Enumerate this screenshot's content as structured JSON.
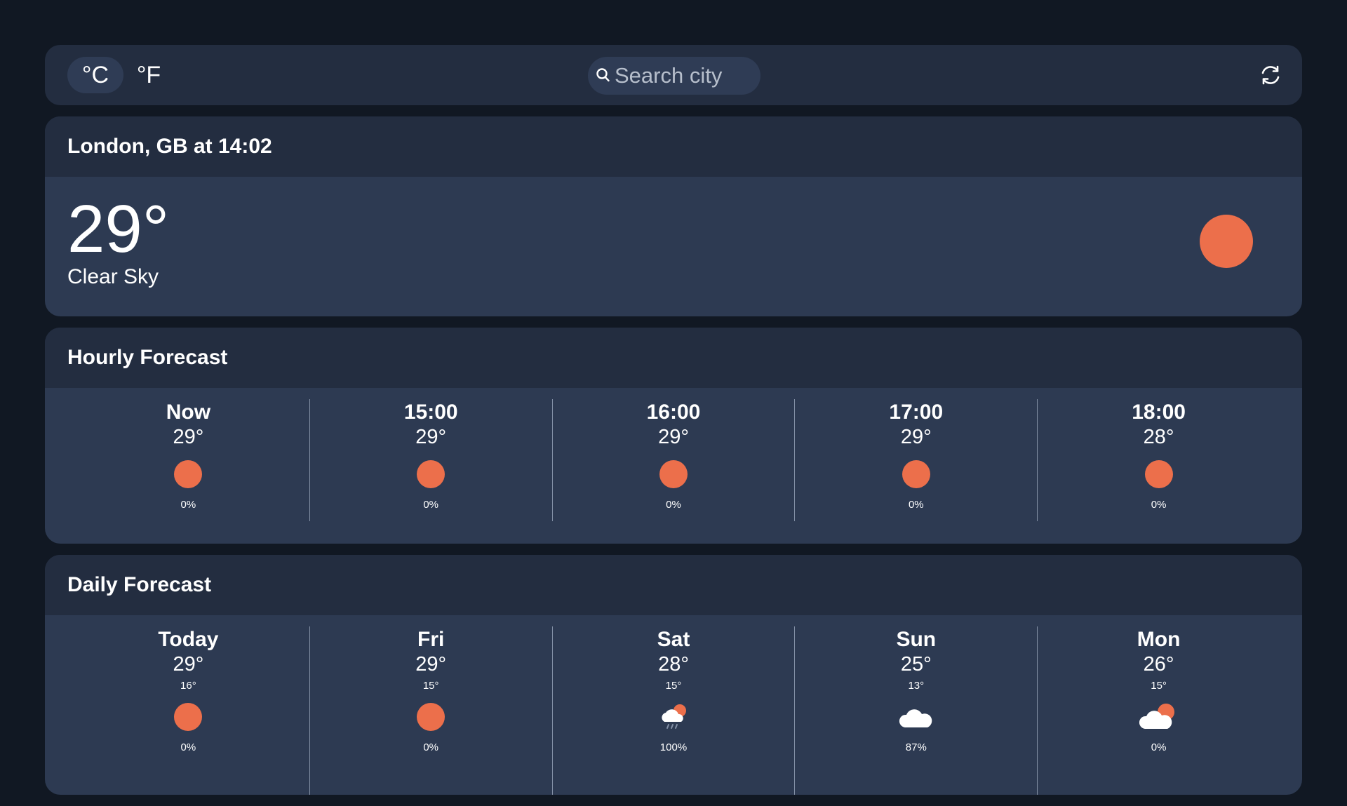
{
  "toolbar": {
    "unit_celsius": "°C",
    "unit_fahrenheit": "°F",
    "search_placeholder": "Search city"
  },
  "current": {
    "location": "London, GB at 14:02",
    "temperature": "29°",
    "condition": "Clear Sky",
    "icon": "sun-icon"
  },
  "hourly": {
    "title": "Hourly Forecast",
    "items": [
      {
        "time": "Now",
        "temp": "29°",
        "precip": "0%",
        "icon": "sun-icon"
      },
      {
        "time": "15:00",
        "temp": "29°",
        "precip": "0%",
        "icon": "sun-icon"
      },
      {
        "time": "16:00",
        "temp": "29°",
        "precip": "0%",
        "icon": "sun-icon"
      },
      {
        "time": "17:00",
        "temp": "29°",
        "precip": "0%",
        "icon": "sun-icon"
      },
      {
        "time": "18:00",
        "temp": "28°",
        "precip": "0%",
        "icon": "sun-icon"
      }
    ]
  },
  "daily": {
    "title": "Daily Forecast",
    "items": [
      {
        "day": "Today",
        "high": "29°",
        "low": "16°",
        "precip": "0%",
        "icon": "sun-icon"
      },
      {
        "day": "Fri",
        "high": "29°",
        "low": "15°",
        "precip": "0%",
        "icon": "sun-icon"
      },
      {
        "day": "Sat",
        "high": "28°",
        "low": "15°",
        "precip": "100%",
        "icon": "rain-cloud-sun-icon"
      },
      {
        "day": "Sun",
        "high": "25°",
        "low": "13°",
        "precip": "87%",
        "icon": "cloud-icon"
      },
      {
        "day": "Mon",
        "high": "26°",
        "low": "15°",
        "precip": "0%",
        "icon": "cloud-sun-icon"
      }
    ]
  },
  "colors": {
    "background": "#111823",
    "card": "#2d3a52",
    "card_header": "#232d40",
    "accent_sun": "#ec6f4b"
  }
}
